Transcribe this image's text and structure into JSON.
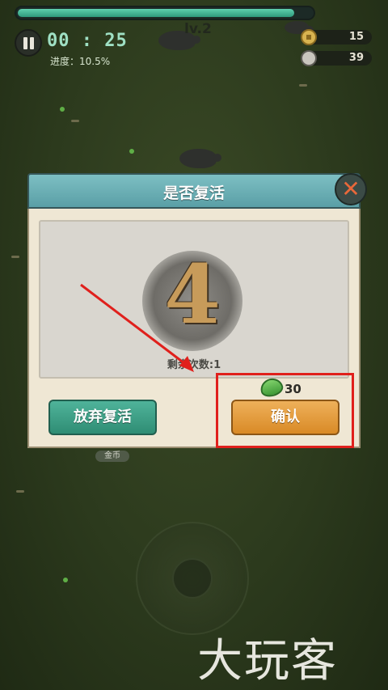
{
  "hud": {
    "xp_progress": 0.94,
    "timer": "00 : 25",
    "progress_text": "进度：10.5%",
    "level": "lv.2",
    "coins": "15",
    "kills": "39"
  },
  "dialog": {
    "title": "是否复活",
    "countdown": "4",
    "revive_count": "剩余次数:1",
    "giveup_label": "放弃复活",
    "confirm_label": "确认",
    "cost_value": "30",
    "close_symbol": "✕"
  },
  "gold_label": "金币",
  "watermark": "大玩客",
  "colors": {
    "highlight": "#e0201c",
    "confirm": "#d98a26",
    "giveup": "#2f8d74",
    "header": "#5a9fa6"
  }
}
